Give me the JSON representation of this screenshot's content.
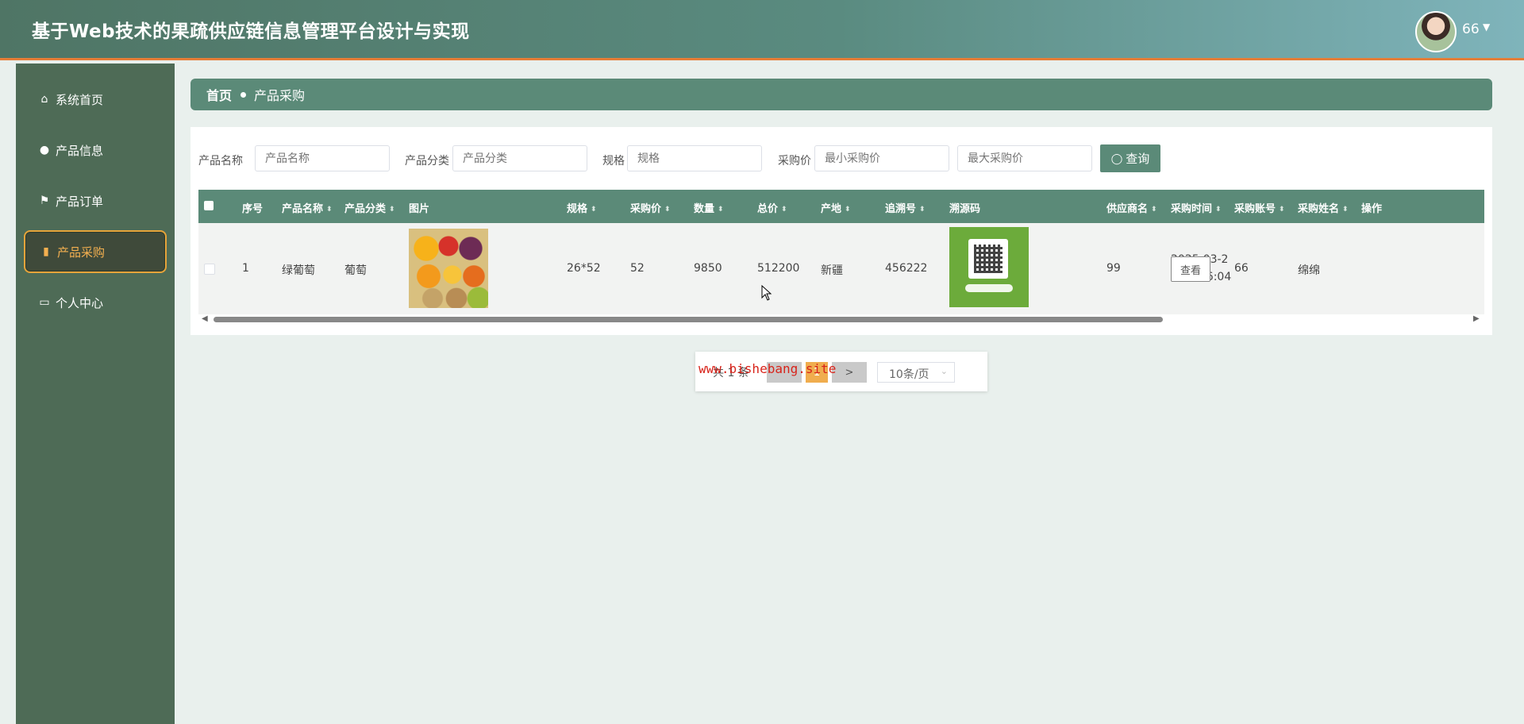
{
  "header": {
    "title": "基于Web技术的果疏供应链信息管理平台设计与实现",
    "user_name": "66",
    "user_caret": "▼"
  },
  "sidebar": {
    "items": [
      {
        "label": "系统首页",
        "icon": "home-icon",
        "glyph": "⌂"
      },
      {
        "label": "产品信息",
        "icon": "bulb-icon",
        "glyph": "●"
      },
      {
        "label": "产品订单",
        "icon": "flag-icon",
        "glyph": "⚑"
      },
      {
        "label": "产品采购",
        "icon": "bar-chart-icon",
        "glyph": "▮",
        "active": true
      },
      {
        "label": "个人中心",
        "icon": "card-icon",
        "glyph": "▭"
      }
    ]
  },
  "breadcrumb": {
    "home": "首页",
    "current": "产品采购"
  },
  "search": {
    "name_label": "产品名称",
    "name_placeholder": "产品名称",
    "category_label": "产品分类",
    "category_placeholder": "产品分类",
    "spec_label": "规格",
    "spec_placeholder": "规格",
    "price_label": "采购价",
    "min_price_placeholder": "最小采购价",
    "max_price_placeholder": "最大采购价",
    "query_label": "查询",
    "query_icon": "search-icon"
  },
  "table": {
    "columns": [
      "序号",
      "产品名称",
      "产品分类",
      "图片",
      "规格",
      "采购价",
      "数量",
      "总价",
      "产地",
      "追溯号",
      "溯源码",
      "供应商名",
      "采购时间",
      "采购账号",
      "采购姓名",
      "操作"
    ],
    "sort_glyph": "⬍",
    "rows": [
      {
        "index": "1",
        "name": "绿葡萄",
        "category": "葡萄",
        "spec": "26*52",
        "price": "52",
        "quantity": "9850",
        "total": "512200",
        "origin": "新疆",
        "trace_no": "456222",
        "supplier": "99",
        "time_line1": "2025-03-2",
        "time_line2": "0 13:46:04",
        "account": "66",
        "buyer": "绵绵",
        "action": "查看"
      }
    ]
  },
  "scroll": {
    "left": "◀",
    "right": "▶"
  },
  "pagination": {
    "total": "共 1 条",
    "prev": "",
    "page": "1",
    "next": ">",
    "page_size": "10条/页",
    "caret": "⌄"
  },
  "watermark": "www.bishebang.site",
  "colors": {
    "primary": "#5b8a78",
    "sidebar": "#4e6b56",
    "accent": "#e6a43a",
    "header_border": "#e57d37"
  }
}
